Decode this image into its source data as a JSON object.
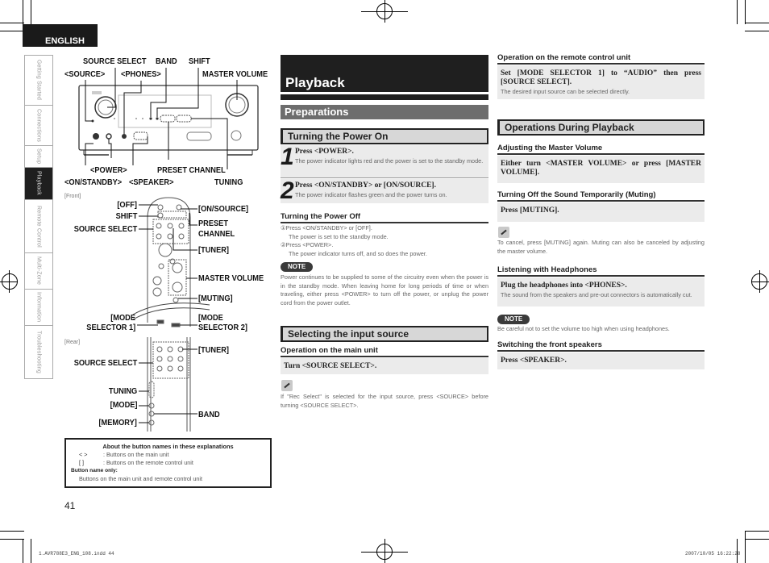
{
  "language_tab": "ENGLISH",
  "side_tabs": [
    {
      "label": "Getting Started",
      "active": false
    },
    {
      "label": "Connections",
      "active": false
    },
    {
      "label": "Setup",
      "active": false
    },
    {
      "label": "Playback",
      "active": true
    },
    {
      "label": "Remote Control",
      "active": false
    },
    {
      "label": "Multi-Zone",
      "active": false
    },
    {
      "label": "Information",
      "active": false
    },
    {
      "label": "Troubleshooting",
      "active": false
    }
  ],
  "main_unit_labels": {
    "source_select": "SOURCE SELECT",
    "band": "BAND",
    "shift": "SHIFT",
    "source": "<SOURCE>",
    "phones": "<PHONES>",
    "master_volume": "MASTER VOLUME",
    "power": "<POWER>",
    "preset_channel": "PRESET CHANNEL",
    "on_standby": "<ON/STANDBY>",
    "speaker": "<SPEAKER>",
    "tuning": "TUNING"
  },
  "remote_labels": {
    "front_caption": "[Front]",
    "rear_caption": "[Rear]",
    "off": "[OFF]",
    "shift": "SHIFT",
    "source_select": "SOURCE SELECT",
    "on_source": "[ON/SOURCE]",
    "preset": "PRESET",
    "channel": "CHANNEL",
    "tuner": "[TUNER]",
    "master_volume": "MASTER VOLUME",
    "muting": "[MUTING]",
    "mode_l1": "[MODE",
    "selector1": "SELECTOR 1]",
    "mode_r1": "[MODE",
    "selector2": "SELECTOR 2]",
    "tuner_rear": "[TUNER]",
    "source_select_rear": "SOURCE SELECT",
    "tuning": "TUNING",
    "mode": "[MODE]",
    "band": "BAND",
    "memory": "[MEMORY]"
  },
  "legend": {
    "title": "About the button names in these explanations",
    "rows": [
      {
        "key": "<    >",
        "desc": ": Buttons on the main unit"
      },
      {
        "key": "[    ]",
        "desc": ": Buttons on the remote control unit"
      }
    ],
    "name_only_label": "Button name only:",
    "name_only_desc": "Buttons on the main unit and remote control unit"
  },
  "page_number": "41",
  "middle": {
    "title": "Playback",
    "section": "Preparations",
    "power_on": {
      "heading": "Turning the Power On",
      "steps": [
        {
          "num": "1",
          "title": "Press <POWER>.",
          "desc": "The power indicator lights red and the power is set to the standby mode."
        },
        {
          "num": "2",
          "title": "Press <ON/STANDBY> or [ON/SOURCE].",
          "desc": "The power indicator flashes green and the power turns on."
        }
      ]
    },
    "power_off": {
      "heading": "Turning the Power Off",
      "items": [
        {
          "marker": "①",
          "text": "Press <ON/STANDBY> or [OFF].",
          "sub": "The power is set to the standby mode."
        },
        {
          "marker": "②",
          "text": "Press <POWER>.",
          "sub": "The power indicator turns off, and so does the power."
        }
      ],
      "note_label": "NOTE",
      "note_text": "Power continues to be supplied to some of the circuitry even when the power is in the standby mode. When leaving home for long periods of time or when traveling, either press <POWER> to turn off the power, or unplug the power cord from the power outlet."
    },
    "input_source": {
      "heading": "Selecting the input source",
      "main_unit_heading": "Operation on the main unit",
      "main_unit_instruction": "Turn <SOURCE SELECT>.",
      "tip_text": "If \"Rec Select\" is selected for the input source, press <SOURCE> before turning <SOURCE SELECT>."
    }
  },
  "right": {
    "remote_heading": "Operation on the remote control unit",
    "remote_instruction": "Set [MODE SELECTOR 1] to “AUDIO” then press [SOURCE SELECT].",
    "remote_desc": "The desired input source can be selected directly.",
    "ops_heading": "Operations During Playback",
    "volume_heading": "Adjusting the Master Volume",
    "volume_instruction": "Either turn <MASTER VOLUME> or press [MASTER VOLUME].",
    "muting_heading": "Turning Off the Sound Temporarily (Muting)",
    "muting_instruction": "Press [MUTING].",
    "muting_tip": "To cancel, press [MUTING] again. Muting can also be canceled by adjusting the master volume.",
    "headphones_heading": "Listening with Headphones",
    "headphones_instruction": "Plug the headphones into <PHONES>.",
    "headphones_desc": "The sound from the speakers and pre-out connectors is automatically cut.",
    "note_label": "NOTE",
    "headphones_note": "Be careful not to set the volume too high when using headphones.",
    "speakers_heading": "Switching the front speakers",
    "speakers_instruction": "Press <SPEAKER>."
  },
  "footer": {
    "file": "1.AVR788E3_ENG_108.indd   44",
    "timestamp": "2007/10/05   16:22:28"
  }
}
